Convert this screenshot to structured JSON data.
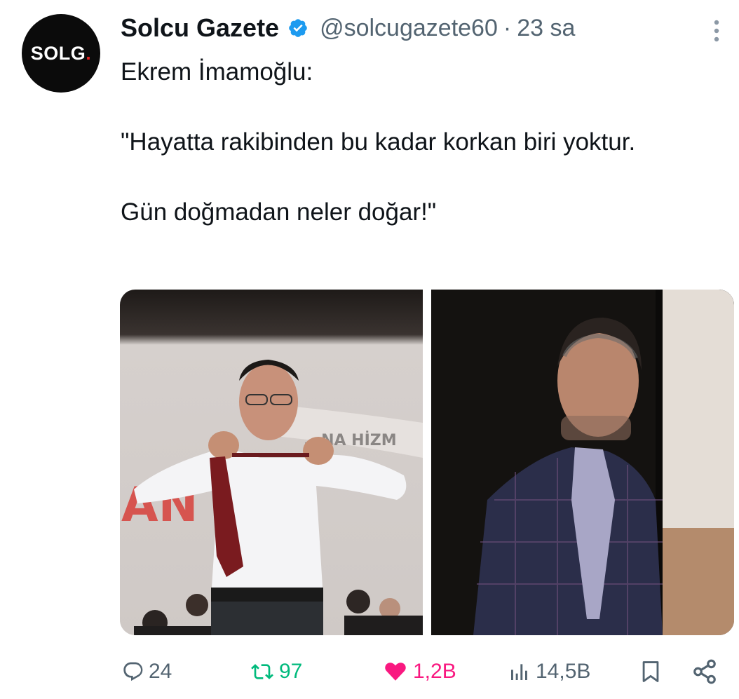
{
  "account": {
    "avatar_text": "SOLG",
    "avatar_dot": ".",
    "display_name": "Solcu Gazete",
    "handle": "@solcugazete60",
    "separator": "·",
    "timestamp": "23 sa",
    "verified": true
  },
  "tweet": {
    "lines": [
      "Ekrem İmamoğlu:",
      "\"Hayatta rakibinden bu kadar korkan biri yoktur.",
      "Gün doğmadan neler doğar!\""
    ]
  },
  "media": {
    "left_photo_sign_text": "...NA HİZM",
    "left_photo_banner_text": "AN  DE"
  },
  "actions": {
    "reply_count": "24",
    "retweet_count": "97",
    "like_count": "1,2B",
    "views_count": "14,5B"
  },
  "icons": {
    "reply": "reply-icon",
    "retweet": "retweet-icon",
    "like": "heart-icon",
    "views": "views-icon",
    "bookmark": "bookmark-icon",
    "share": "share-icon",
    "more": "more-icon",
    "verified": "verified-badge-icon"
  },
  "colors": {
    "text": "#0f1419",
    "secondary": "#536471",
    "verified": "#1d9bf0",
    "retweet": "#00ba7c",
    "like": "#f91880",
    "brand_red": "#e0201f"
  }
}
